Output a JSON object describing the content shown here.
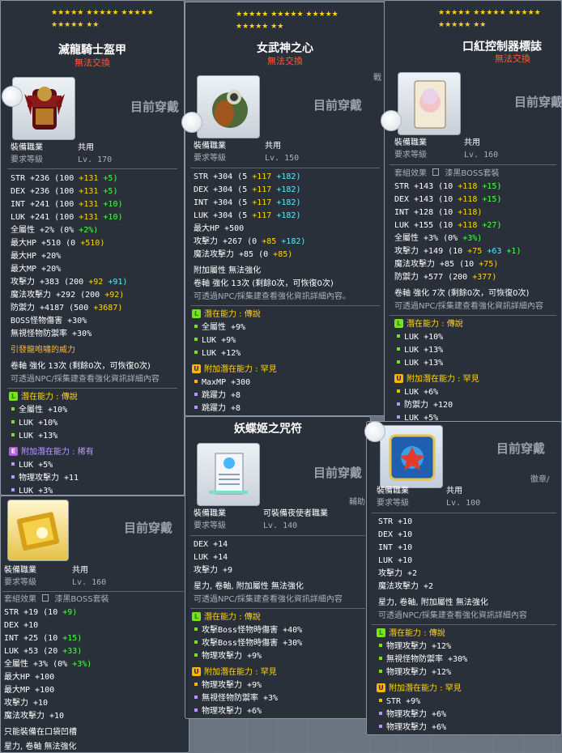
{
  "common": {
    "untradeable": "無法交換",
    "wearing": "目前穿戴",
    "job_label": "裝備職業",
    "job_value": "共用",
    "level_label": "要求等級",
    "stars_row1": "★★★★★ ★★★★★ ★★★★★",
    "stars_row2": "★★★★★ ★★"
  },
  "card1": {
    "title": "滅龍騎士盔甲",
    "level": "Lv. 170",
    "stats": [
      "STR  +236 (100 ",
      "DEX  +236 (100 ",
      "INT  +241 (100 ",
      "LUK  +241 (100 "
    ],
    "stats_y": [
      "+131 ",
      "+131 ",
      "+131 ",
      "+131 "
    ],
    "stats_c": [
      "+5)",
      "+5)",
      "+10)",
      "+10)"
    ],
    "allstat": "全屬性  +2% (0% ",
    "allstat_c": "+2%)",
    "maxhp": "最大HP  +510 (0 ",
    "maxhp_y": "+510)",
    "maxhp2": "最大HP  +20%",
    "maxmp2": "最大MP  +20%",
    "att": "攻擊力  +383 (200 ",
    "att_y": "+92 ",
    "att_c": "+91)",
    "matt": "魔法攻擊力  +292 (200 ",
    "matt_y": "+92)",
    "def": "防禦力  +4187 (500 ",
    "def_y": "+3687)",
    "boss": "BOSS怪物傷害  +30%",
    "ied": "無視怪物防禦率  +30%",
    "flavor": "引發龍咆嘯的威力",
    "scroll": "卷軸 強化 13次 (剩餘0次，可恢復0次)",
    "npc": "可透過NPC/採集建查看強化資訊詳細內容",
    "pot_header": "潛在能力 : 傳說",
    "pot": [
      "全屬性  +10%",
      "LUK  +10%",
      "LUK  +13%"
    ],
    "add_header": "附加潛在能力 : 稀有",
    "add": [
      "LUK  +5%",
      "物理攻擊力  +11",
      "LUK  +3%"
    ]
  },
  "card2": {
    "title": "女武神之心",
    "level": "Lv. 150",
    "side_glyph": "戰",
    "stats": [
      "STR  +304 (5 ",
      "DEX  +304 (5 ",
      "INT  +304 (5 ",
      "LUK  +304 (5 "
    ],
    "stats_y": [
      "+117 ",
      "+117 ",
      "+117 ",
      "+117 "
    ],
    "stats_c": [
      "+182)",
      "+182)",
      "+182)",
      "+182)"
    ],
    "maxhp": "最大HP  +500",
    "att": "攻擊力  +267 (0 ",
    "att_y": "+85 ",
    "att_c": "+182)",
    "matt": "魔法攻擊力  +85 (0 ",
    "matt_y": "+85)",
    "addattr": "附加屬性 無法強化",
    "scroll": "卷軸 強化 13次 (剩餘0次，可恢復0次)",
    "npc": "可透過NPC/採集建查看強化資訊詳細內容。",
    "pot_header": "潛在能力 : 傳說",
    "pot": [
      "全屬性  +9%",
      "LUK  +9%",
      "LUK  +12%"
    ],
    "add_header": "附加潛在能力 : 罕見",
    "add": [
      "MaxMP  +300",
      "跳躍力  +8",
      "跳躍力  +8"
    ]
  },
  "card3": {
    "title": "口紅控制器標誌",
    "level": "Lv. 160",
    "setfx": "套組效果",
    "setname": "漆黑BOSS套裝",
    "stats": [
      "STR  +143 (10 ",
      "DEX  +143 (10 ",
      "INT  +128 (10 ",
      "LUK  +155 (10 "
    ],
    "stats_y": [
      "+118 ",
      "+118 ",
      "+118)",
      "+118 "
    ],
    "stats_c": [
      "+15)",
      "+15)",
      "",
      "+27)"
    ],
    "allstat": "全屬性  +3% (0% ",
    "allstat_c": "+3%)",
    "att": "攻擊力  +149 (10 ",
    "att_y": "+75 ",
    "att_c": "+63 ",
    "att_g": "+1)",
    "matt": "魔法攻擊力  +85 (10 ",
    "matt_y": "+75)",
    "def": "防禦力  +577 (200 ",
    "def_y": "+377)",
    "scroll": "卷軸 強化 7次 (剩餘0次，可恢復0次)",
    "npc": "可透過NPC/採集建查看強化資訊詳細內容",
    "pot_header": "潛在能力 : 傳說",
    "pot": [
      "LUK  +10%",
      "LUK  +13%",
      "LUK  +13%"
    ],
    "add_header": "附加潛在能力 : 罕見",
    "add": [
      "LUK  +6%",
      "防禦力  +120",
      "LUK  +5%"
    ]
  },
  "card4": {
    "level": "Lv. 160",
    "setfx": "套組效果",
    "setname": "漆黑BOSS套裝",
    "lines": [
      [
        "STR  +19 (10 ",
        "+9)",
        ""
      ],
      [
        "DEX  +10",
        "",
        ""
      ],
      [
        "INT  +25 (10 ",
        "+15)",
        ""
      ],
      [
        "LUK  +53 (20 ",
        "+33)",
        ""
      ]
    ],
    "allstat": "全屬性  +3% (0% ",
    "allstat_c": "+3%)",
    "rest": [
      "最大HP  +100",
      "最大MP  +100",
      "攻擊力  +10",
      "魔法攻擊力  +10"
    ],
    "pocket": "只能裝備在口袋凹槽",
    "scroll": "星力, 卷軸 無法強化"
  },
  "card5": {
    "title": "妖蝶姬之咒符",
    "job_value": "可裝備夜使者職業",
    "level": "Lv. 140",
    "side_glyph": "輔助",
    "stats": [
      "DEX  +14",
      "LUK  +14",
      "攻擊力  +9"
    ],
    "noenh": "星力, 卷軸, 附加屬性 無法強化",
    "npc": "可透過NPC/採集建查看強化資訊詳細內容",
    "pot_header": "潛在能力 : 傳說",
    "pot": [
      "攻擊Boss怪物時傷害  +40%",
      "攻擊Boss怪物時傷害  +30%",
      "物理攻擊力  +9%"
    ],
    "add_header": "附加潛在能力 : 罕見",
    "add": [
      "物理攻擊力  +9%",
      "無視怪物防禦率  +3%",
      "物理攻擊力  +6%"
    ]
  },
  "card6": {
    "level": "Lv. 100",
    "side_glyph": "徽章/",
    "stats": [
      "STR  +10",
      "DEX  +10",
      "INT  +10",
      "LUK  +10",
      "攻擊力  +2",
      "魔法攻擊力  +2"
    ],
    "noenh": "星力, 卷軸, 附加屬性 無法強化",
    "npc": "可透過NPC/採集建查看強化資訊詳細內容",
    "pot_header": "潛在能力 : 傳說",
    "pot": [
      "物理攻擊力  +12%",
      "無視怪物防禦率  +30%",
      "物理攻擊力  +12%"
    ],
    "add_header": "附加潛在能力 : 罕見",
    "add": [
      "STR  +9%",
      "物理攻擊力  +6%",
      "物理攻擊力  +6%"
    ]
  }
}
